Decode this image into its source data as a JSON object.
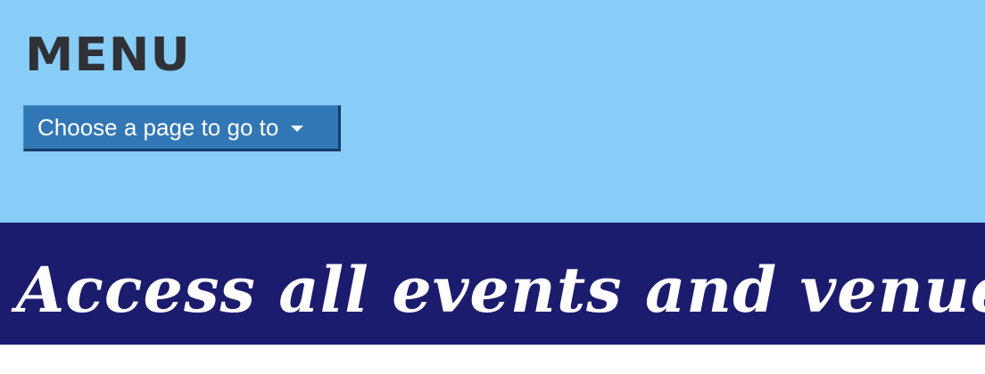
{
  "menu": {
    "title": "MENU",
    "dropdown": {
      "label": "Choose a page to go to",
      "icon": "chevron-down-icon"
    }
  },
  "banner": {
    "text": "Access all events and venues from"
  },
  "colors": {
    "menu_background": "#87cdf8",
    "dropdown_background": "#3277b5",
    "banner_background": "#1c1c6e",
    "title_text": "#2f3136"
  }
}
